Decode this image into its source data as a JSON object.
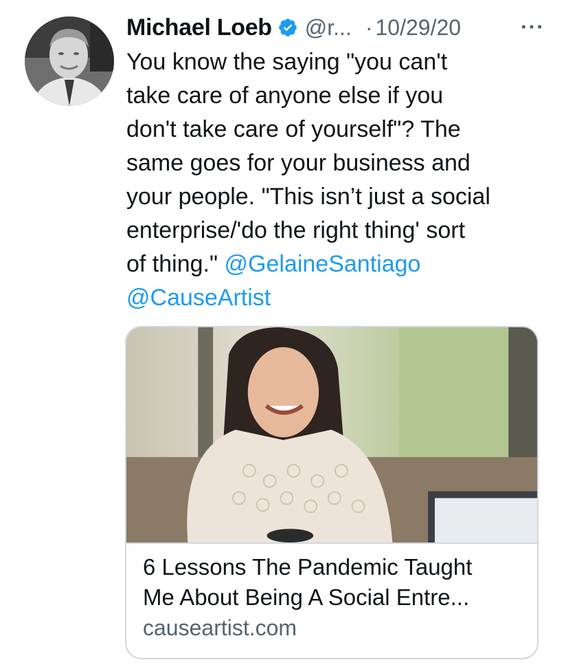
{
  "tweet": {
    "author_name": "Michael Loeb",
    "verified_icon": "verified-badge-icon",
    "handle": "@r...",
    "separator": "·",
    "date": "10/29/20",
    "more_icon": "more-horizontal-icon",
    "text_lines": [
      "You know the saying \"you can't",
      "take care of anyone else if you",
      "don't take care of yourself\"? The",
      "same goes for your business and",
      "your people. \"This isn’t just a social",
      "enterprise/'do the right thing' sort"
    ],
    "text_last_line_prefix": "of thing.\" ",
    "mentions": [
      "@GelaineSantiago",
      "@CauseArtist"
    ]
  },
  "card": {
    "title_lines": [
      "6 Lessons The Pandemic Taught",
      "Me About Being A Social Entre..."
    ],
    "domain": "causeartist.com"
  },
  "colors": {
    "accent": "#1d9bf0",
    "secondary_text": "#536471",
    "primary_text": "#0f1419",
    "border": "#cfd9de"
  }
}
